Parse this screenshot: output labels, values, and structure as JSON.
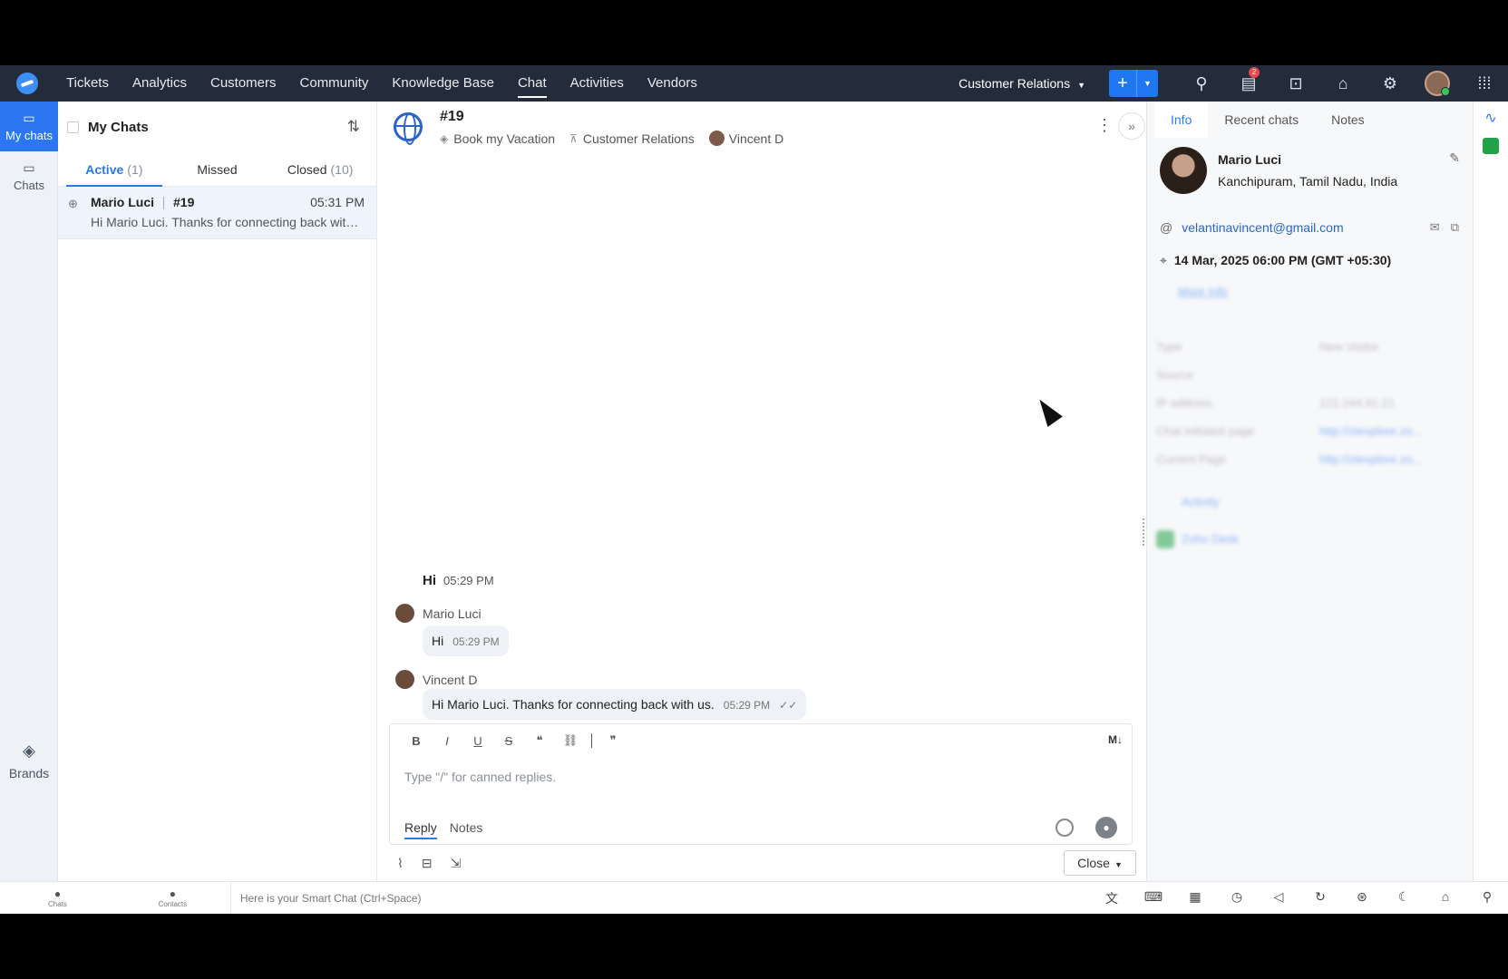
{
  "nav": {
    "items": [
      "Tickets",
      "Analytics",
      "Customers",
      "Community",
      "Knowledge Base",
      "Chat",
      "Activities",
      "Vendors"
    ],
    "active": "Chat",
    "department": "Customer Relations",
    "notification_count": "2",
    "plus_label": "+"
  },
  "rail": {
    "my_chats": "My chats",
    "chats": "Chats",
    "brands": "Brands"
  },
  "list": {
    "title": "My Chats",
    "tabs": [
      {
        "label": "Active",
        "count": "(1)"
      },
      {
        "label": "Missed",
        "count": ""
      },
      {
        "label": "Closed",
        "count": "(10)"
      }
    ],
    "chat": {
      "name": "Mario Luci",
      "id": "#19",
      "time": "05:31 PM",
      "preview": "Hi Mario Luci. Thanks for connecting back with us."
    }
  },
  "conversation": {
    "id": "#19",
    "brand": "Book my Vacation",
    "department": "Customer Relations",
    "agent": "Vincent D",
    "messages": {
      "first": {
        "text": "Hi",
        "time": "05:29 PM"
      },
      "visitor": {
        "name": "Mario Luci",
        "text": "Hi",
        "time": "05:29 PM"
      },
      "agent": {
        "name": "Vincent D",
        "text": "Hi Mario Luci. Thanks for connecting back with us.",
        "time": "05:29 PM"
      }
    },
    "composer": {
      "placeholder": "Type \"/\" for canned replies.",
      "tab_reply": "Reply",
      "tab_notes": "Notes",
      "close_label": "Close"
    }
  },
  "info": {
    "tabs": [
      "Info",
      "Recent chats",
      "Notes"
    ],
    "name": "Mario Luci",
    "location": "Kanchipuram, Tamil Nadu, India",
    "email": "velantinavincent@gmail.com",
    "datetime": "14 Mar, 2025 06:00 PM  (GMT +05:30)",
    "more_info": "More Info",
    "fields": [
      {
        "key": "Type",
        "value": "New Visitor"
      },
      {
        "key": "Source",
        "value": ""
      },
      {
        "key": "IP address",
        "value": "121.244.91.21"
      },
      {
        "key": "Chat initiated page",
        "value": "http://ztexplore.zo..."
      },
      {
        "key": "Current Page",
        "value": "http://ztexplore.zo..."
      }
    ],
    "activity": "Activity",
    "zoho_desk": "Zoho Desk"
  },
  "statusbar": {
    "chats": "Chats",
    "contacts": "Contacts",
    "smart_chat": "Here is your Smart Chat (Ctrl+Space)"
  }
}
